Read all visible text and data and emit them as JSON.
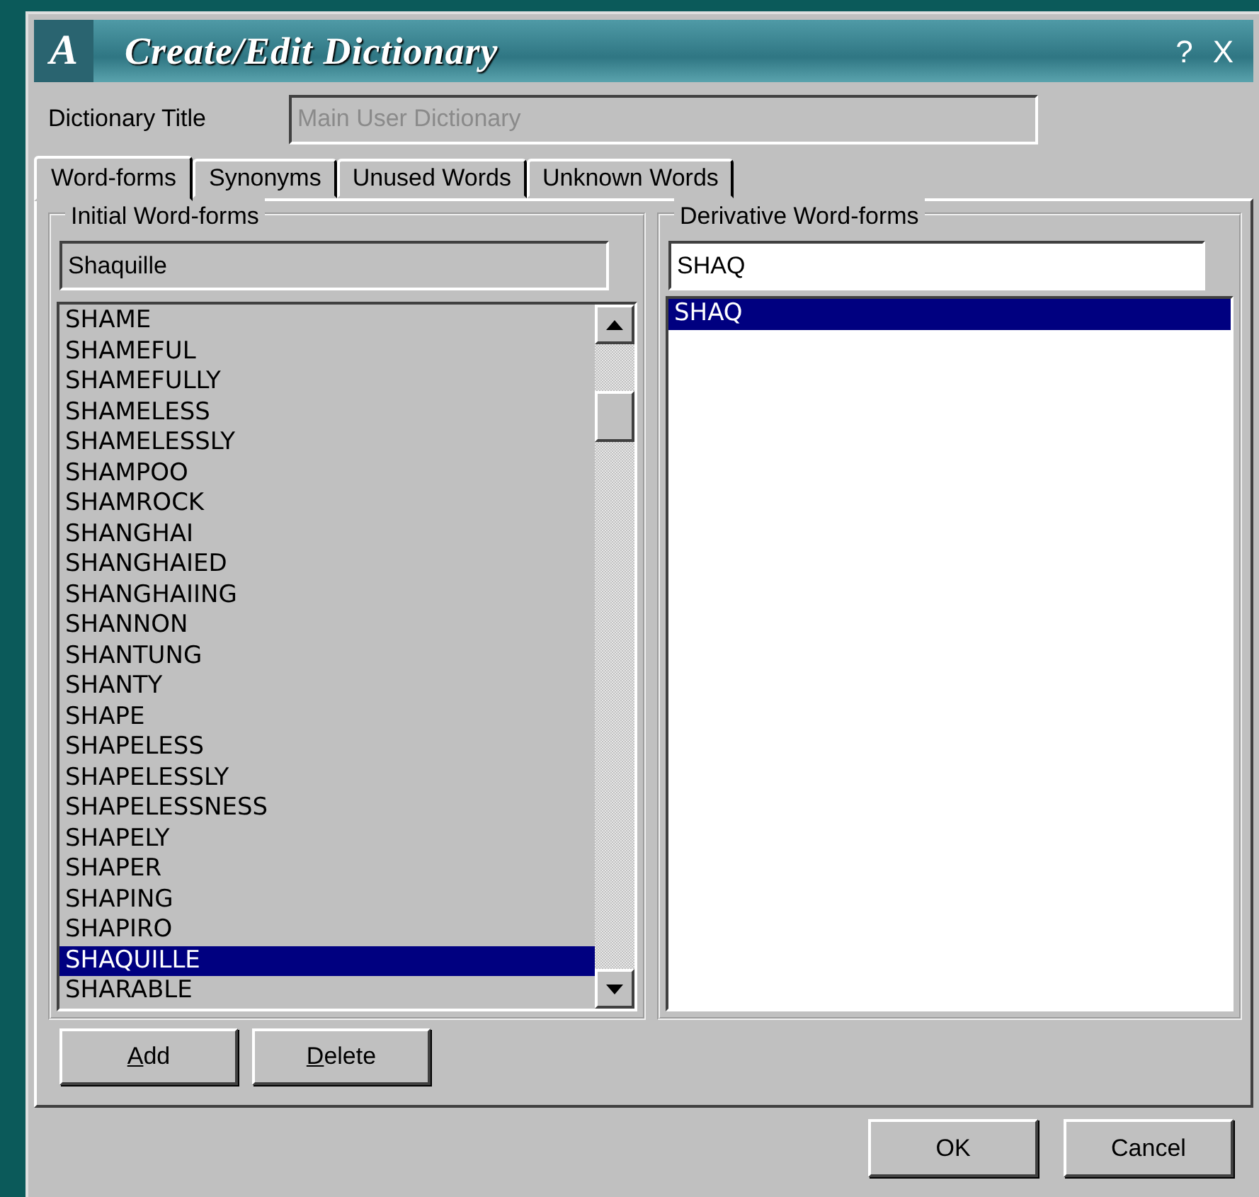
{
  "window": {
    "title": "Create/Edit Dictionary",
    "icon_letter": "A",
    "help": "?",
    "close": "X"
  },
  "dictionary_title": {
    "label": "Dictionary Title",
    "value": "Main User Dictionary",
    "disabled": true
  },
  "tabs": [
    {
      "label": "Word-forms",
      "selected": true
    },
    {
      "label": "Synonyms",
      "selected": false
    },
    {
      "label": "Unused Words",
      "selected": false
    },
    {
      "label": "Unknown Words",
      "selected": false
    }
  ],
  "initial": {
    "title": "Initial Word-forms",
    "value": "Shaquille",
    "items": [
      {
        "text": "SHAME",
        "selected": false
      },
      {
        "text": "SHAMEFUL",
        "selected": false
      },
      {
        "text": "SHAMEFULLY",
        "selected": false
      },
      {
        "text": "SHAMELESS",
        "selected": false
      },
      {
        "text": "SHAMELESSLY",
        "selected": false
      },
      {
        "text": "SHAMPOO",
        "selected": false
      },
      {
        "text": "SHAMROCK",
        "selected": false
      },
      {
        "text": "SHANGHAI",
        "selected": false
      },
      {
        "text": "SHANGHAIED",
        "selected": false
      },
      {
        "text": "SHANGHAIING",
        "selected": false
      },
      {
        "text": "SHANNON",
        "selected": false
      },
      {
        "text": "SHANTUNG",
        "selected": false
      },
      {
        "text": "SHANTY",
        "selected": false
      },
      {
        "text": "SHAPE",
        "selected": false
      },
      {
        "text": "SHAPELESS",
        "selected": false
      },
      {
        "text": "SHAPELESSLY",
        "selected": false
      },
      {
        "text": "SHAPELESSNESS",
        "selected": false
      },
      {
        "text": "SHAPELY",
        "selected": false
      },
      {
        "text": "SHAPER",
        "selected": false
      },
      {
        "text": "SHAPING",
        "selected": false
      },
      {
        "text": "SHAPIRO",
        "selected": false
      },
      {
        "text": "SHAQUILLE",
        "selected": true
      },
      {
        "text": "SHARABLE",
        "selected": false
      }
    ]
  },
  "derivative": {
    "title": "Derivative Word-forms",
    "value": "SHAQ",
    "items": [
      {
        "text": "SHAQ",
        "selected": true
      }
    ]
  },
  "actions": [
    {
      "label": "Add",
      "first_letter_underlined": true
    },
    {
      "label": "Delete",
      "first_letter_underlined": true
    }
  ],
  "buttons": [
    {
      "label": "OK"
    },
    {
      "label": "Cancel"
    }
  ]
}
